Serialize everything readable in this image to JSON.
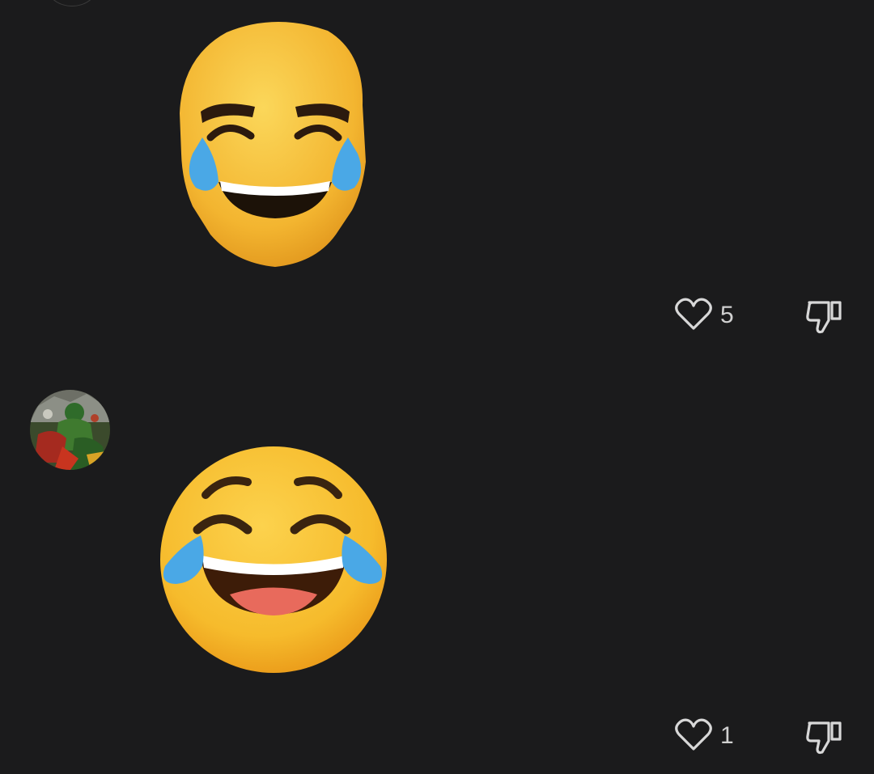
{
  "comments": [
    {
      "sticker": "trollface-laughing-tears-sticker",
      "likes": "5",
      "like_icon": "heart-outline-icon",
      "dislike_icon": "thumbs-down-icon"
    },
    {
      "avatar": "comic-art-avatar",
      "sticker": "face-with-tears-of-joy-sticker",
      "likes": "1",
      "like_icon": "heart-outline-icon",
      "dislike_icon": "thumbs-down-icon"
    }
  ],
  "colors": {
    "background": "#1b1b1c",
    "emoji_yellow": "#f7c53a",
    "tear_blue": "#4aa8e6",
    "icon": "#d8d8d8"
  }
}
